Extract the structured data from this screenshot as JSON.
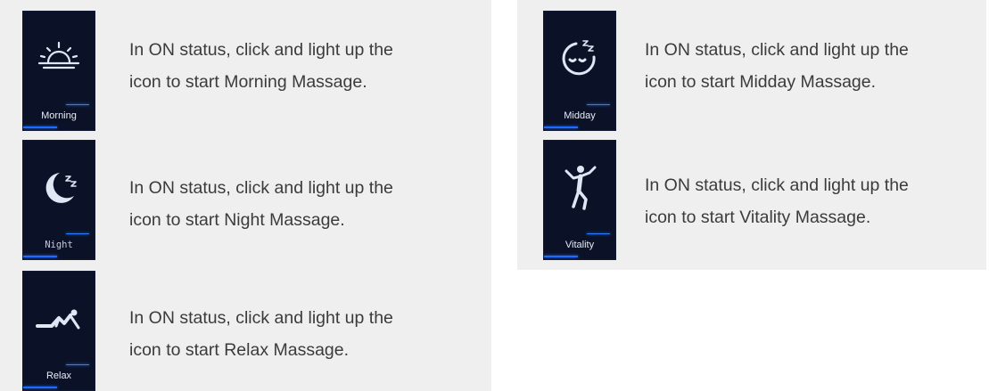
{
  "modes": [
    {
      "id": "morning",
      "label": "Morning",
      "icon": "sunrise-icon",
      "line1": "In ON status, click and light up the",
      "line2": "icon to start Morning Massage."
    },
    {
      "id": "night",
      "label": "Night",
      "icon": "moon-sleep-icon",
      "line1": "In ON status, click and light up the",
      "line2": "icon to start Night Massage."
    },
    {
      "id": "relax",
      "label": "Relax",
      "icon": "reclining-person-icon",
      "line1": "In ON status, click and light up the",
      "line2": "icon to start Relax Massage."
    },
    {
      "id": "midday",
      "label": "Midday",
      "icon": "nap-face-icon",
      "line1": "In ON status, click and light up the",
      "line2": "icon to start Midday Massage."
    },
    {
      "id": "vitality",
      "label": "Vitality",
      "icon": "jumping-person-icon",
      "line1": "In ON status, click and light up the",
      "line2": "icon to start Vitality Massage."
    }
  ],
  "colors": {
    "tile_bg": "#0b1228",
    "icon": "#dfe7f5",
    "accent_glow": "#2a7fff",
    "panel_bg": "#efefef",
    "text": "#3b3b3b"
  }
}
